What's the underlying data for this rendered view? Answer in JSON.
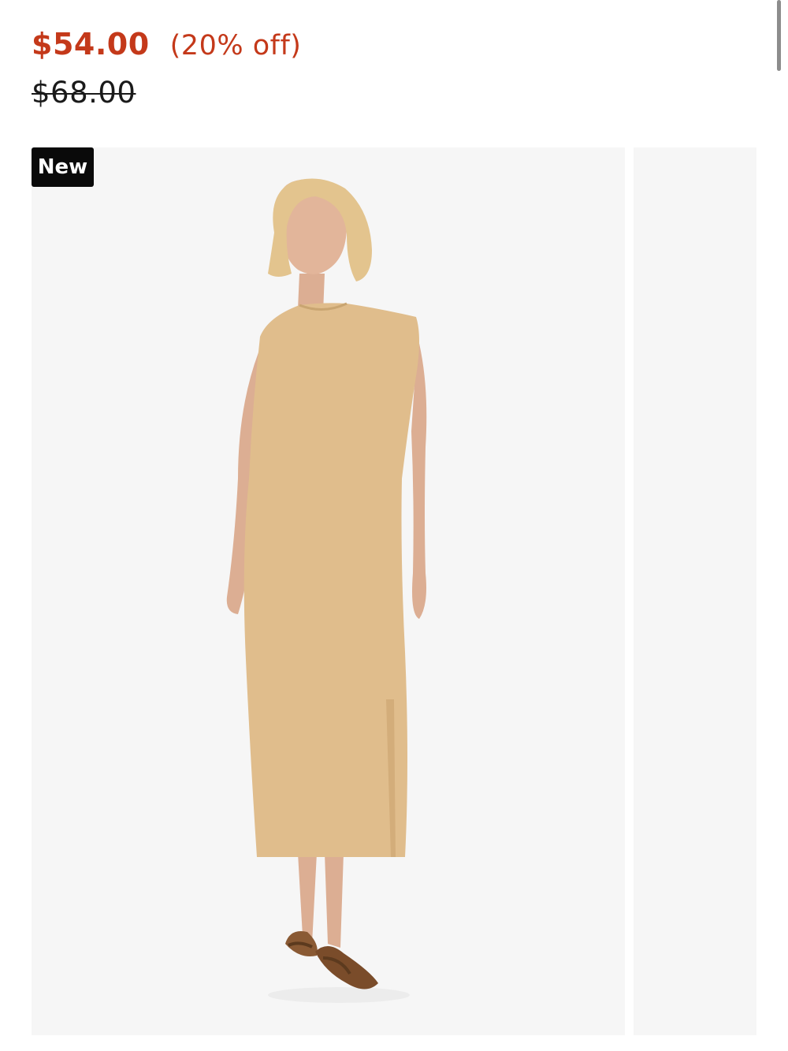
{
  "pricing": {
    "sale_price": "$54.00",
    "discount": "(20% off)",
    "original_price": "$68.00"
  },
  "gallery": {
    "badge": "New",
    "image_alt": "Model wearing a sleeveless tan midi dress with side slit and brown sandals"
  },
  "product": {
    "title_peek": ""
  },
  "colors": {
    "sale": "#c4391a",
    "dress": "#e0bd8c",
    "background": "#f6f6f6"
  }
}
